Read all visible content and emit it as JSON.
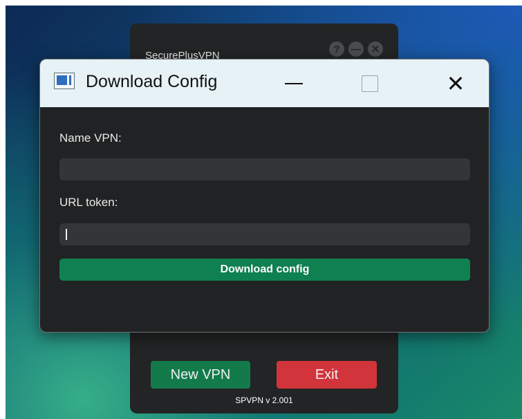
{
  "main_window": {
    "title": "SecurePlusVPN",
    "icons": [
      "help-icon",
      "minimize-icon",
      "close-icon"
    ],
    "new_vpn_label": "New VPN",
    "exit_label": "Exit",
    "version": "SPVPN v 2.001"
  },
  "dialog": {
    "title": "Download Config",
    "name_label": "Name VPN:",
    "name_value": "",
    "url_label": "URL token:",
    "url_value": "",
    "download_label": "Download config"
  },
  "colors": {
    "accent_green": "#0f8050",
    "exit_red": "#d2343c",
    "titlebar": "#e7f2f7",
    "panel": "#212223"
  }
}
